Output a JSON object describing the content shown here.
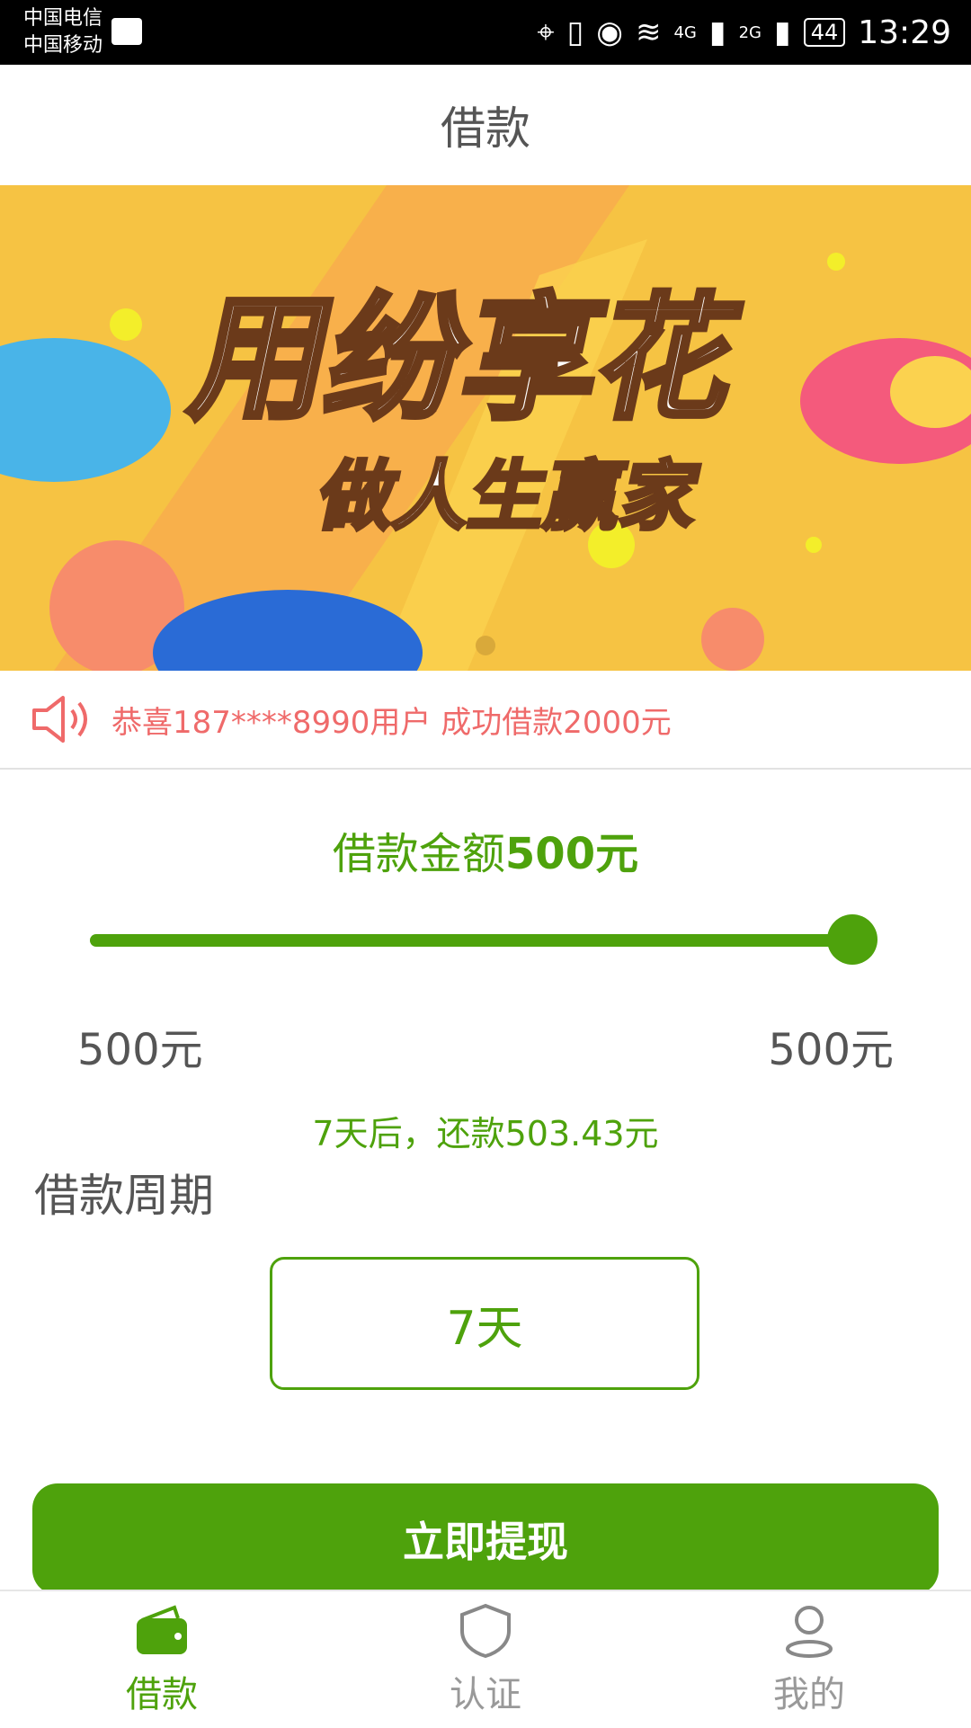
{
  "status_bar": {
    "carrier1": "中国电信",
    "carrier2": "中国移动",
    "net1": "4G",
    "net2": "2G",
    "battery": "44",
    "time": "13:29"
  },
  "header": {
    "title": "借款"
  },
  "banner": {
    "headline": "用纷享花",
    "subline": "做人生赢家",
    "page_index": 1,
    "page_count": 1
  },
  "notice": {
    "icon": "speaker-icon",
    "text": "恭喜187****8990用户 成功借款2000元"
  },
  "loan": {
    "amount_label": "借款金额",
    "amount_value": "500元",
    "slider_min": 500,
    "slider_max": 500,
    "slider_value": 500,
    "min_label": "500元",
    "max_label": "500元",
    "repay_text": "7天后，还款503.43元",
    "period_label": "借款周期",
    "period_option": "7天",
    "submit_label": "立即提现"
  },
  "bottom_nav": [
    {
      "label": "借款",
      "icon": "wallet-icon",
      "active": true
    },
    {
      "label": "认证",
      "icon": "shield-icon",
      "active": false
    },
    {
      "label": "我的",
      "icon": "user-icon",
      "active": false
    }
  ],
  "colors": {
    "accent": "#4ea20c",
    "notice": "#ef6a6a",
    "banner_bg": "#f6c343"
  }
}
